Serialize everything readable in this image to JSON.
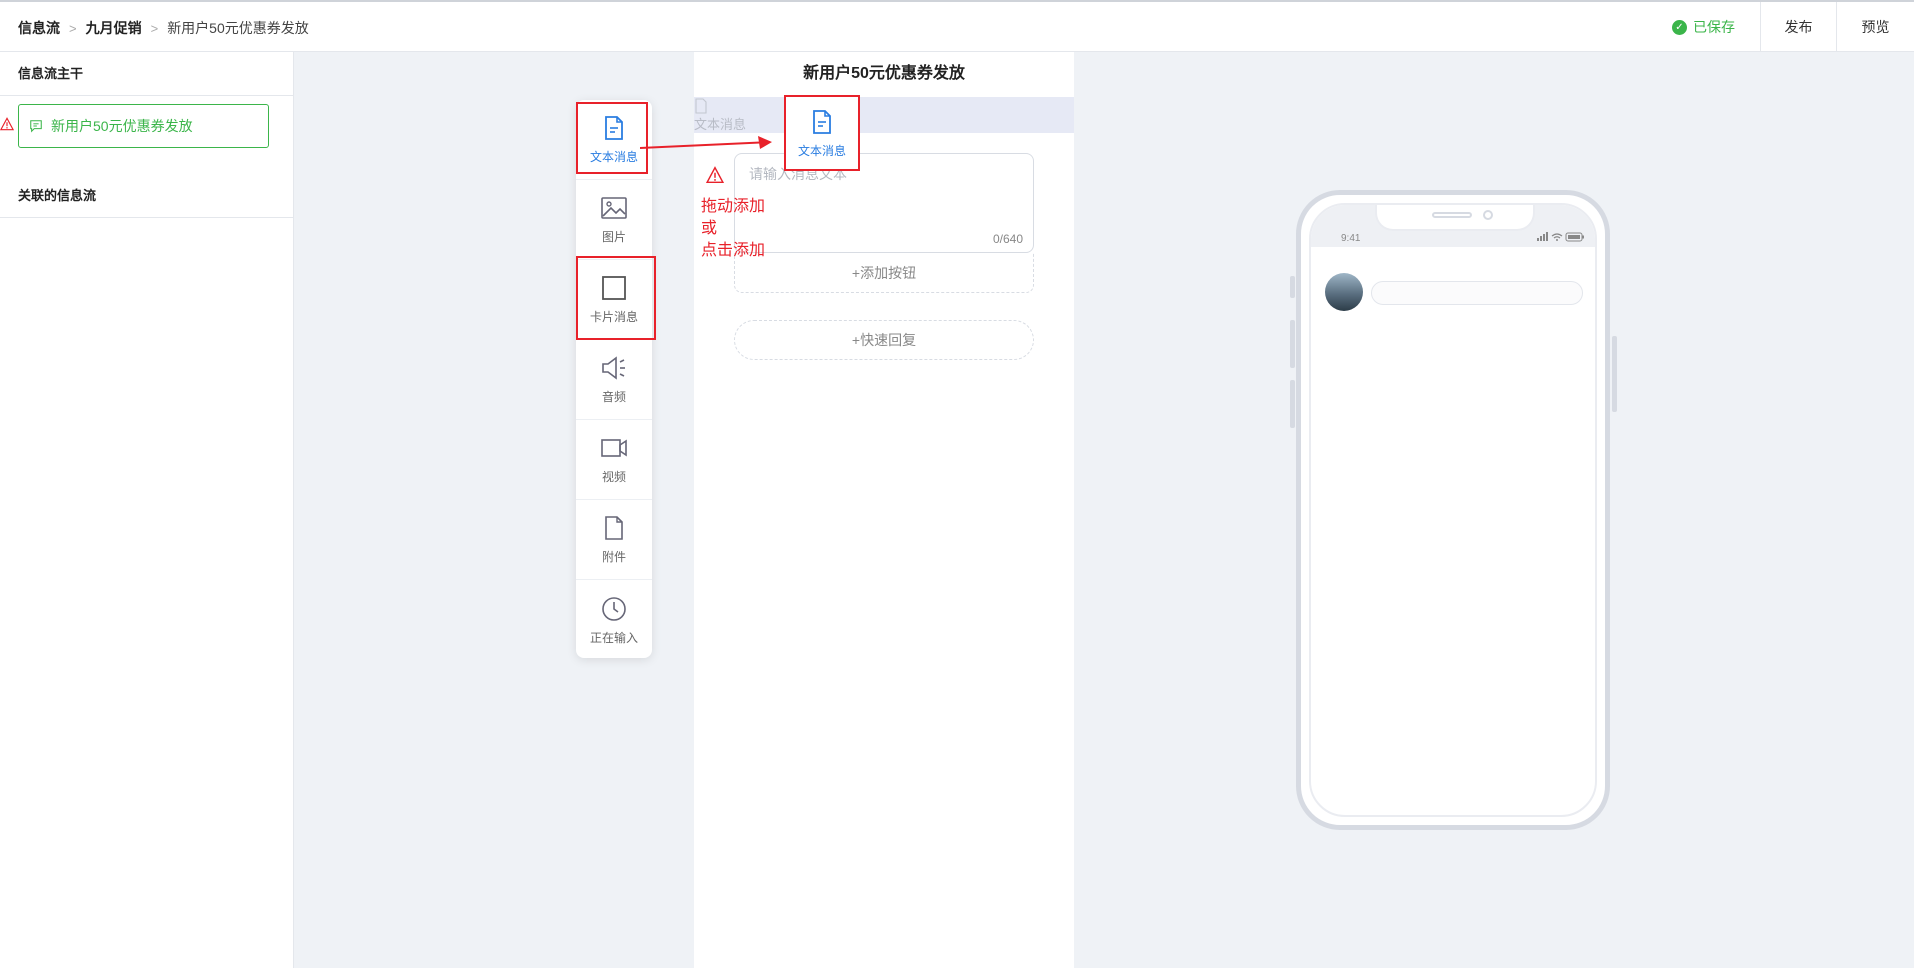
{
  "breadcrumb": {
    "items": [
      "信息流",
      "九月促销",
      "新用户50元优惠券发放"
    ]
  },
  "header": {
    "saved_label": "已保存",
    "publish_label": "发布",
    "preview_label": "预览"
  },
  "sidebar": {
    "main_title": "信息流主干",
    "active_item": "新用户50元优惠券发放",
    "related_title": "关联的信息流"
  },
  "palette": {
    "items": [
      {
        "label": "文本消息",
        "icon": "text-message-icon"
      },
      {
        "label": "图片",
        "icon": "image-icon"
      },
      {
        "label": "卡片消息",
        "icon": "card-icon"
      },
      {
        "label": "音频",
        "icon": "audio-icon"
      },
      {
        "label": "视频",
        "icon": "video-icon"
      },
      {
        "label": "附件",
        "icon": "attachment-icon"
      },
      {
        "label": "正在输入",
        "icon": "typing-clock-icon"
      }
    ]
  },
  "editor": {
    "title": "新用户50元优惠券发放",
    "ghost_label": "文本消息",
    "placeholder": "请输入消息文本",
    "counter": "0/640",
    "add_button_label": "+添加按钮",
    "quick_reply_label": "+快速回复"
  },
  "annotation": {
    "drag_card_label": "文本消息",
    "hint_lines": [
      "拖动添加",
      "或",
      "点击添加"
    ]
  },
  "phone": {
    "time": "9:41"
  },
  "colors": {
    "accent_green": "#3bb54a",
    "accent_blue": "#2a7de1",
    "annotation_red": "#e8212a"
  }
}
